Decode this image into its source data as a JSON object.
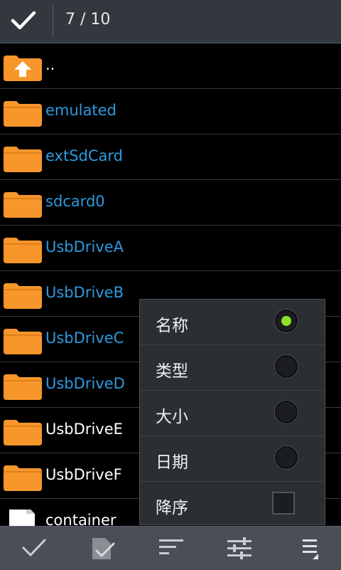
{
  "topbar": {
    "counter": "7 / 10"
  },
  "files": [
    {
      "name": "..",
      "type": "up",
      "selected": false
    },
    {
      "name": "emulated",
      "type": "folder",
      "selected": true
    },
    {
      "name": "extSdCard",
      "type": "folder",
      "selected": true
    },
    {
      "name": "sdcard0",
      "type": "folder",
      "selected": true
    },
    {
      "name": "UsbDriveA",
      "type": "folder",
      "selected": true
    },
    {
      "name": "UsbDriveB",
      "type": "folder",
      "selected": true
    },
    {
      "name": "UsbDriveC",
      "type": "folder",
      "selected": true
    },
    {
      "name": "UsbDriveD",
      "type": "folder",
      "selected": true
    },
    {
      "name": "UsbDriveE",
      "type": "folder",
      "selected": false
    },
    {
      "name": "UsbDriveF",
      "type": "folder",
      "selected": false
    },
    {
      "name": "container",
      "type": "file",
      "selected": false
    }
  ],
  "sort_menu": {
    "items": [
      {
        "label": "名称",
        "control": "radio",
        "checked": true
      },
      {
        "label": "类型",
        "control": "radio",
        "checked": false
      },
      {
        "label": "大小",
        "control": "radio",
        "checked": false
      },
      {
        "label": "日期",
        "control": "radio",
        "checked": false
      },
      {
        "label": "降序",
        "control": "checkbox",
        "checked": false
      }
    ]
  },
  "toolbar": {
    "buttons": [
      {
        "icon": "check-icon"
      },
      {
        "icon": "select-all-icon"
      },
      {
        "icon": "sort-icon"
      },
      {
        "icon": "filter-sliders-icon"
      },
      {
        "icon": "menu-icon"
      }
    ]
  },
  "colors": {
    "selected_text": "#2c9be0",
    "folder": "#f7962a",
    "radio_on": "#8ee02a",
    "topbar": "#33383f",
    "toolbar": "#4a4f57"
  }
}
